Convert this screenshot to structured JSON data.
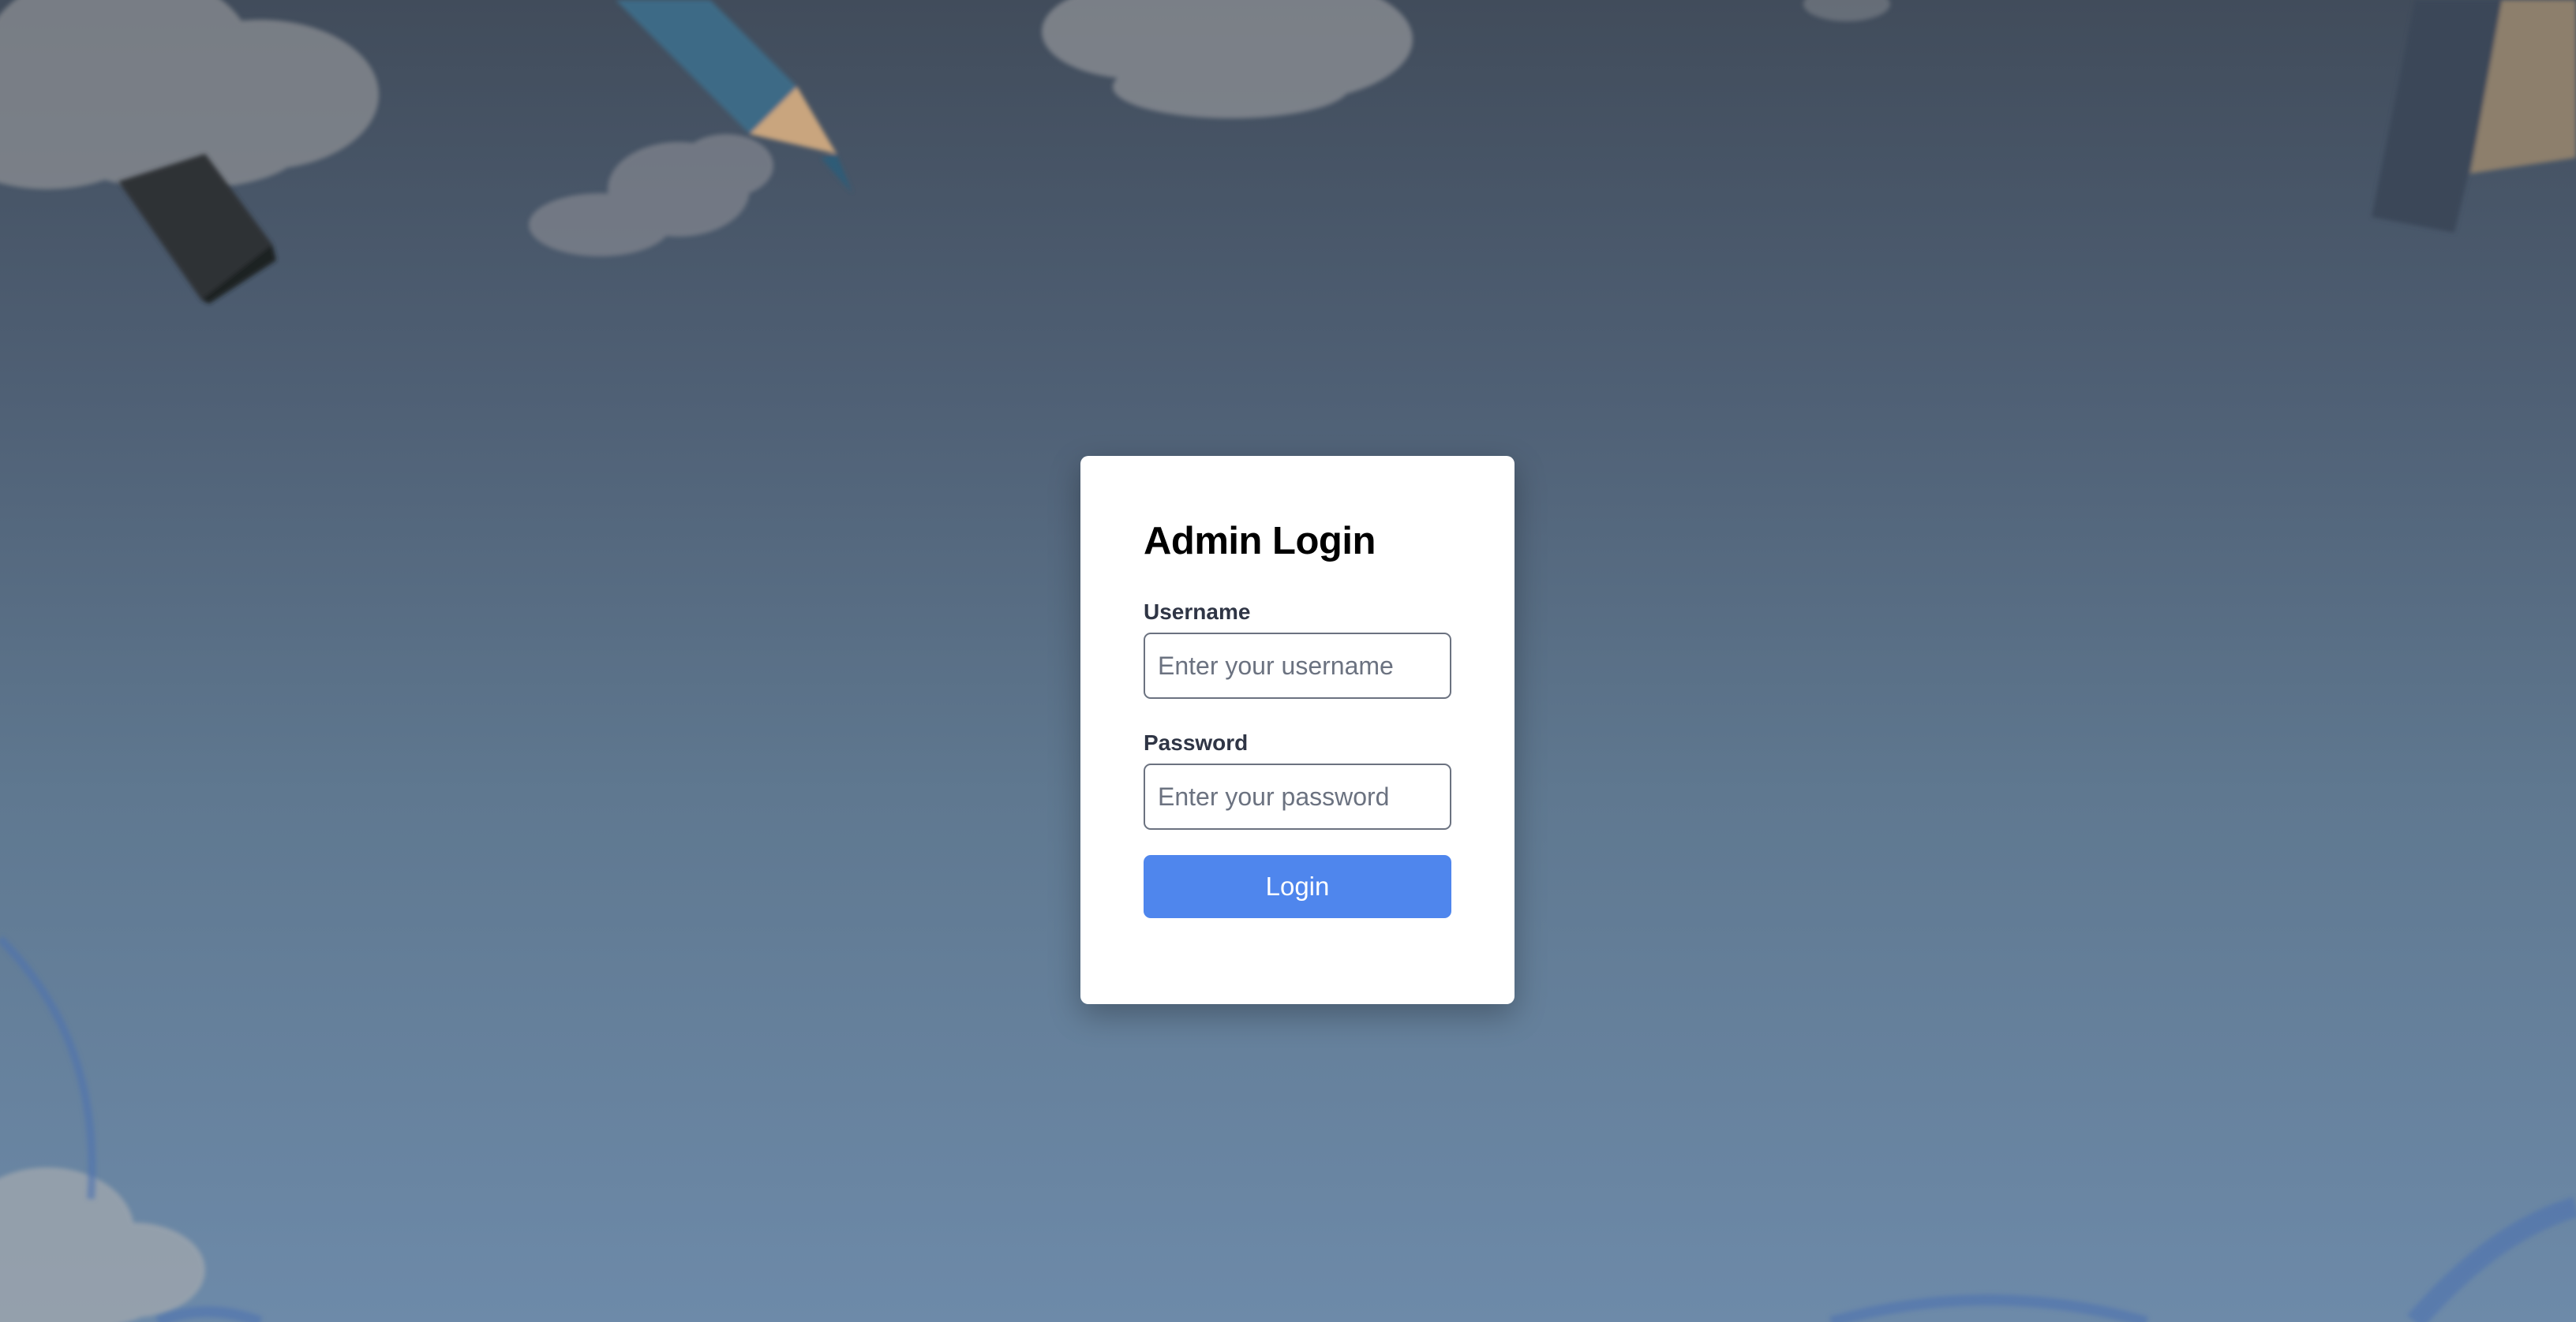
{
  "login_form": {
    "title": "Admin Login",
    "username_label": "Username",
    "username_placeholder": "Enter your username",
    "username_value": "",
    "password_label": "Password",
    "password_placeholder": "Enter your password",
    "password_value": "",
    "submit_label": "Login"
  },
  "colors": {
    "primary_button": "#4f86ed",
    "card_background": "#ffffff",
    "label_text": "#2f3545",
    "input_border": "#6b7280"
  },
  "background": {
    "decorations": [
      "cloud",
      "pencil",
      "marker-cap",
      "ruler",
      "arc"
    ]
  }
}
